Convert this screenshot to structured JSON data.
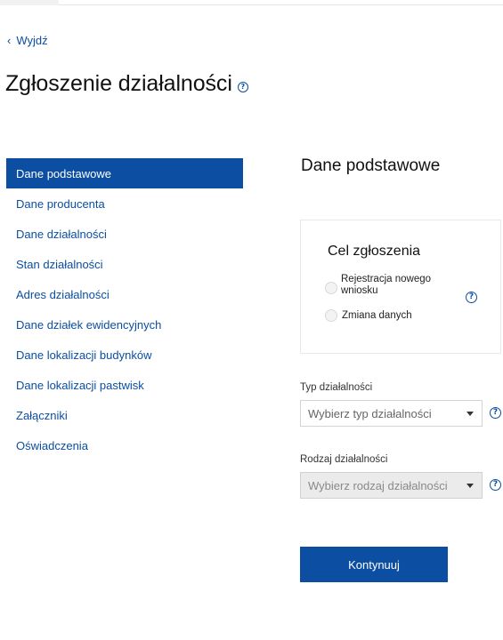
{
  "header": {
    "back_label": "Wyjdź",
    "page_title": "Zgłoszenie działalności"
  },
  "sidebar": {
    "items": [
      {
        "label": "Dane podstawowe",
        "active": true
      },
      {
        "label": "Dane producenta",
        "active": false
      },
      {
        "label": "Dane działalności",
        "active": false
      },
      {
        "label": "Stan działalności",
        "active": false
      },
      {
        "label": "Adres działalności",
        "active": false
      },
      {
        "label": "Dane działek ewidencyjnych",
        "active": false
      },
      {
        "label": "Dane lokalizacji budynków",
        "active": false
      },
      {
        "label": "Dane lokalizacji pastwisk",
        "active": false
      },
      {
        "label": "Załączniki",
        "active": false
      },
      {
        "label": "Oświadczenia",
        "active": false
      }
    ]
  },
  "main": {
    "section_title": "Dane podstawowe",
    "purpose": {
      "title": "Cel zgłoszenia",
      "options": [
        {
          "label_line1": "Rejestracja nowego",
          "label_line2": "wniosku",
          "selected": false
        },
        {
          "label": "Zmiana danych",
          "selected": false
        }
      ]
    },
    "activity_type": {
      "label": "Typ działalności",
      "placeholder": "Wybierz typ działalności",
      "disabled": false
    },
    "activity_kind": {
      "label": "Rodzaj działalności",
      "placeholder": "Wybierz rodzaj działalności",
      "disabled": true
    },
    "continue_label": "Kontynuuj"
  },
  "icons": {
    "help": "?",
    "back": "‹"
  },
  "colors": {
    "primary": "#0b4ea2",
    "disabled_bg": "#ebebeb",
    "border": "#d4d4d4"
  }
}
